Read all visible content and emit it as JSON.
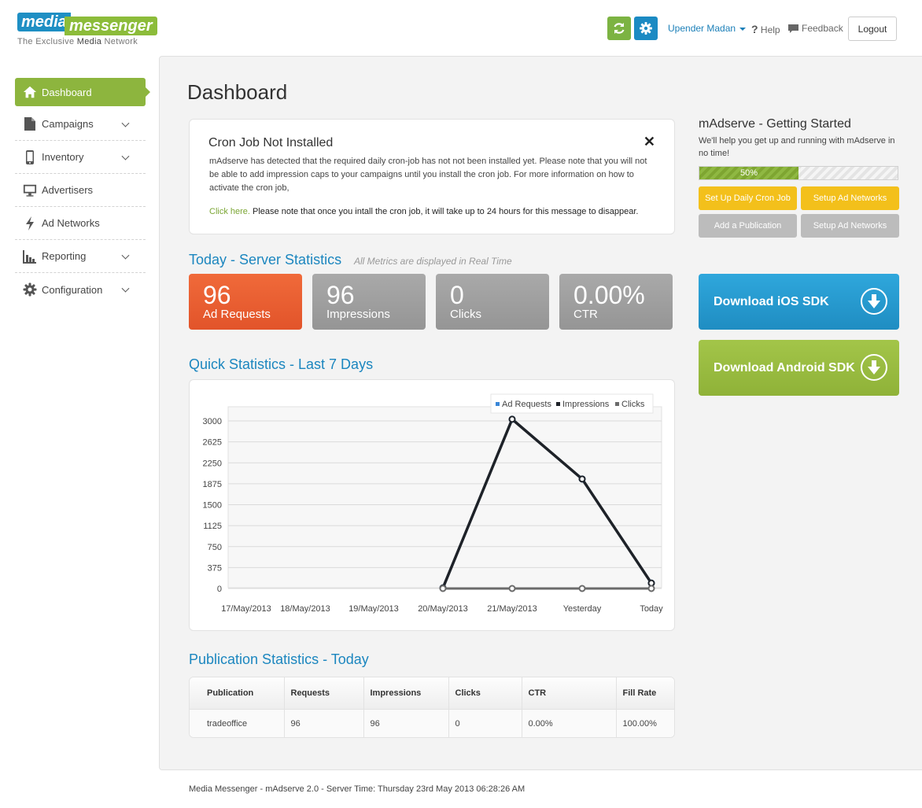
{
  "brand": {
    "logo_part1": "media",
    "logo_part2": "messenger",
    "tagline_pre": "The Exclusive ",
    "tagline_bold": "Media",
    "tagline_post": " Network"
  },
  "header": {
    "user_name": "Upender Madan",
    "help_label": "Help",
    "feedback_label": "Feedback",
    "logout_label": "Logout"
  },
  "sidebar": {
    "items": [
      {
        "label": "Dashboard",
        "icon": "home-icon",
        "active": true
      },
      {
        "label": "Campaigns",
        "icon": "document-icon"
      },
      {
        "label": "Inventory",
        "icon": "phone-icon"
      },
      {
        "label": "Advertisers",
        "icon": "monitor-icon"
      },
      {
        "label": "Ad Networks",
        "icon": "bolt-icon"
      },
      {
        "label": "Reporting",
        "icon": "chart-icon"
      },
      {
        "label": "Configuration",
        "icon": "gear-icon"
      }
    ]
  },
  "page": {
    "title": "Dashboard"
  },
  "cron": {
    "title": "Cron Job Not Installed",
    "message": "mAdserve has detected that the required daily cron-job has not not been installed yet. Please note that you will not be able to add impression caps to your campaigns until you install the cron job. For more information on how to activate the cron job,",
    "link_text": "Click here.",
    "note": " Please note that once you intall the cron job, it will take up to 24 hours for this message to disappear.",
    "close_glyph": "✕"
  },
  "server_stats": {
    "title": "Today - Server Statistics",
    "subtitle": "All Metrics are displayed in Real Time",
    "tiles": [
      {
        "value": "96",
        "label": "Ad Requests",
        "color": "#e9602f"
      },
      {
        "value": "96",
        "label": "Impressions",
        "color": "#a0a0a0"
      },
      {
        "value": "0",
        "label": "Clicks",
        "color": "#a0a0a0"
      },
      {
        "value": "0.00%",
        "label": "CTR",
        "color": "#a0a0a0"
      }
    ]
  },
  "quick_stats": {
    "title": "Quick Statistics - Last 7 Days"
  },
  "chart_data": {
    "type": "line",
    "title": "",
    "xlabel": "",
    "ylabel": "",
    "categories": [
      "17/May/2013",
      "18/May/2013",
      "19/May/2013",
      "20/May/2013",
      "21/May/2013",
      "Yesterday",
      "Today"
    ],
    "ylim": [
      0,
      3000
    ],
    "yticks": [
      "0",
      "375",
      "750",
      "1125",
      "1500",
      "1875",
      "2250",
      "2625",
      "3000"
    ],
    "grid": true,
    "legend_position": "top-right",
    "series": [
      {
        "name": "Ad Requests",
        "color": "#3a87d8",
        "values": [
          null,
          null,
          null,
          10,
          3030,
          1960,
          96
        ]
      },
      {
        "name": "Impressions",
        "color": "#1e2228",
        "values": [
          null,
          null,
          null,
          10,
          3030,
          1960,
          96
        ]
      },
      {
        "name": "Clicks",
        "color": "#6b6b6b",
        "values": [
          null,
          null,
          null,
          0,
          0,
          0,
          0
        ]
      }
    ]
  },
  "publication_stats": {
    "title": "Publication Statistics - Today",
    "columns": [
      "Publication",
      "Requests",
      "Impressions",
      "Clicks",
      "CTR",
      "Fill Rate"
    ],
    "rows": [
      [
        "tradeoffice",
        "96",
        "96",
        "0",
        "0.00%",
        "100.00%"
      ]
    ]
  },
  "getting_started": {
    "title": "mAdserve - Getting Started",
    "text": "We'll help you get up and running with mAdserve in no time!",
    "progress_fraction": 0.5,
    "progress_label": "50%",
    "buttons": [
      {
        "label": "Set Up Daily Cron Job",
        "color": "#f3c01b"
      },
      {
        "label": "Setup Ad Networks",
        "color": "#f3c01b"
      },
      {
        "label": "Add a Publication",
        "color": "#bcbcbc"
      },
      {
        "label": "Setup Ad Networks",
        "color": "#bcbcbc"
      }
    ]
  },
  "sdk": {
    "ios_label": "Download iOS SDK",
    "android_label": "Download Android SDK"
  },
  "footer": {
    "text": "Media Messenger - mAdserve 2.0 - Server Time: Thursday 23rd May 2013 06:28:26 AM"
  }
}
